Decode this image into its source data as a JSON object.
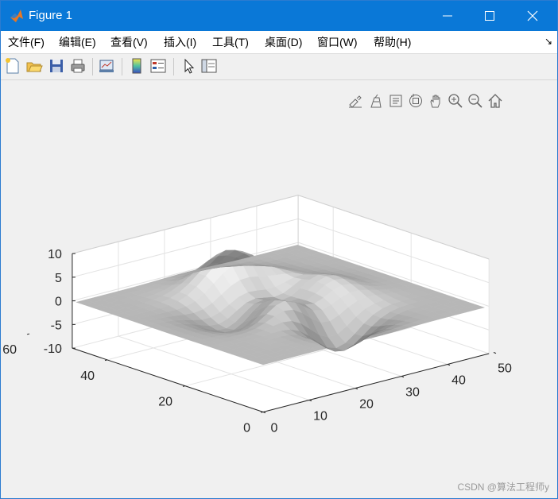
{
  "window": {
    "title": "Figure 1",
    "accent_color": "#0a78d7",
    "icon": "matlab-logo-icon"
  },
  "menu": {
    "items": [
      "文件(F)",
      "编辑(E)",
      "查看(V)",
      "插入(I)",
      "工具(T)",
      "桌面(D)",
      "窗口(W)",
      "帮助(H)"
    ]
  },
  "toolbar": {
    "buttons": [
      "new-figure-icon",
      "open-file-icon",
      "save-icon",
      "print-icon",
      "link-plot-icon",
      "insert-colorbar-icon",
      "insert-legend-icon",
      "edit-plot-pointer-icon",
      "property-inspector-icon"
    ]
  },
  "axes_toolbar": {
    "buttons": [
      "brush-edit-icon",
      "data-tips-icon",
      "data-cursor-icon",
      "rotate-3d-icon",
      "pan-hand-icon",
      "zoom-in-icon",
      "zoom-out-icon",
      "restore-view-home-icon"
    ]
  },
  "chart_data": {
    "type": "surface",
    "title": "",
    "xlabel": "",
    "ylabel": "",
    "zlabel": "",
    "x_ticks": [
      "0",
      "10",
      "20",
      "30",
      "40",
      "50"
    ],
    "y_ticks": [
      "0",
      "20",
      "40",
      "60"
    ],
    "z_ticks": [
      "10",
      "5",
      "0",
      "-5",
      "-10"
    ],
    "xlim": [
      0,
      49
    ],
    "ylim": [
      0,
      49
    ],
    "zlim": [
      -10,
      10
    ],
    "grid": true,
    "colormap": "gray",
    "function": "peaks(49)",
    "features": [
      {
        "kind": "peak",
        "z": 8
      },
      {
        "kind": "peak",
        "z": 3.8
      },
      {
        "kind": "peak",
        "z": 3.5
      },
      {
        "kind": "trough",
        "z": -6.5
      },
      {
        "kind": "trough",
        "z": -3
      }
    ]
  },
  "watermark": "CSDN @算法工程师y"
}
